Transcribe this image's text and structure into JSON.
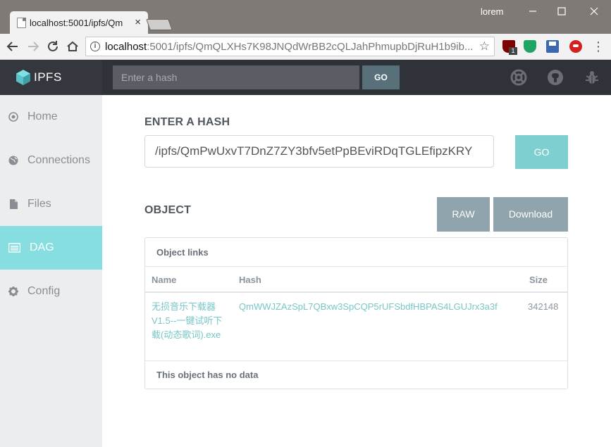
{
  "browser": {
    "tab_title": "localhost:5001/ipfs/Qm",
    "tab_close": "×",
    "user_name": "lorem",
    "url_host": "localhost",
    "url_rest": ":5001/ipfs/QmQLXHs7K98JNQdWrBB2cQLJahPhmupbDjRuH1b9ib...",
    "extension_badge": "1",
    "icons": [
      "back-arrow-icon",
      "forward-arrow-icon",
      "reload-icon",
      "home-icon",
      "info-icon",
      "star-icon",
      "ublock-icon",
      "shield-icon",
      "save-icon",
      "red-extension-icon",
      "menu-dots-icon"
    ]
  },
  "header": {
    "brand": "IPFS",
    "search_placeholder": "Enter a hash",
    "go_label": "GO",
    "icons": [
      "help-icon",
      "github-icon",
      "bug-icon"
    ]
  },
  "sidebar": {
    "items": [
      {
        "label": "Home",
        "icon": "home-icon",
        "active": false
      },
      {
        "label": "Connections",
        "icon": "globe-icon",
        "active": false
      },
      {
        "label": "Files",
        "icon": "file-icon",
        "active": false
      },
      {
        "label": "DAG",
        "icon": "list-icon",
        "active": true
      },
      {
        "label": "Config",
        "icon": "gear-icon",
        "active": false
      }
    ]
  },
  "main": {
    "enter_hash_title": "ENTER A HASH",
    "path_value": "/ipfs/QmPwUxvT7DnZ7ZY3bfv5etPpBEviRDqTGLEfipzKRY",
    "go_label": "GO",
    "object_title": "OBJECT",
    "raw_label": "RAW",
    "download_label": "Download",
    "links_title": "Object links",
    "columns": {
      "name": "Name",
      "hash": "Hash",
      "size": "Size"
    },
    "links": [
      {
        "name_lines": [
          "无损音乐下载器",
          "V1.5--一键试听下",
          "载(动态歌词).exe"
        ],
        "hash": "QmWWJZAzSpL7QBxw3SpCQP5rUFSbdfHBPAS4LGUJrx3a3f",
        "size": "342148"
      }
    ],
    "no_data": "This object has no data"
  },
  "colors": {
    "header_bg": "#2f3339",
    "accent_teal": "#86dee0",
    "go_button": "#7ed0d0",
    "action_button": "#8fa4ac",
    "link_text": "#78c6c6"
  }
}
